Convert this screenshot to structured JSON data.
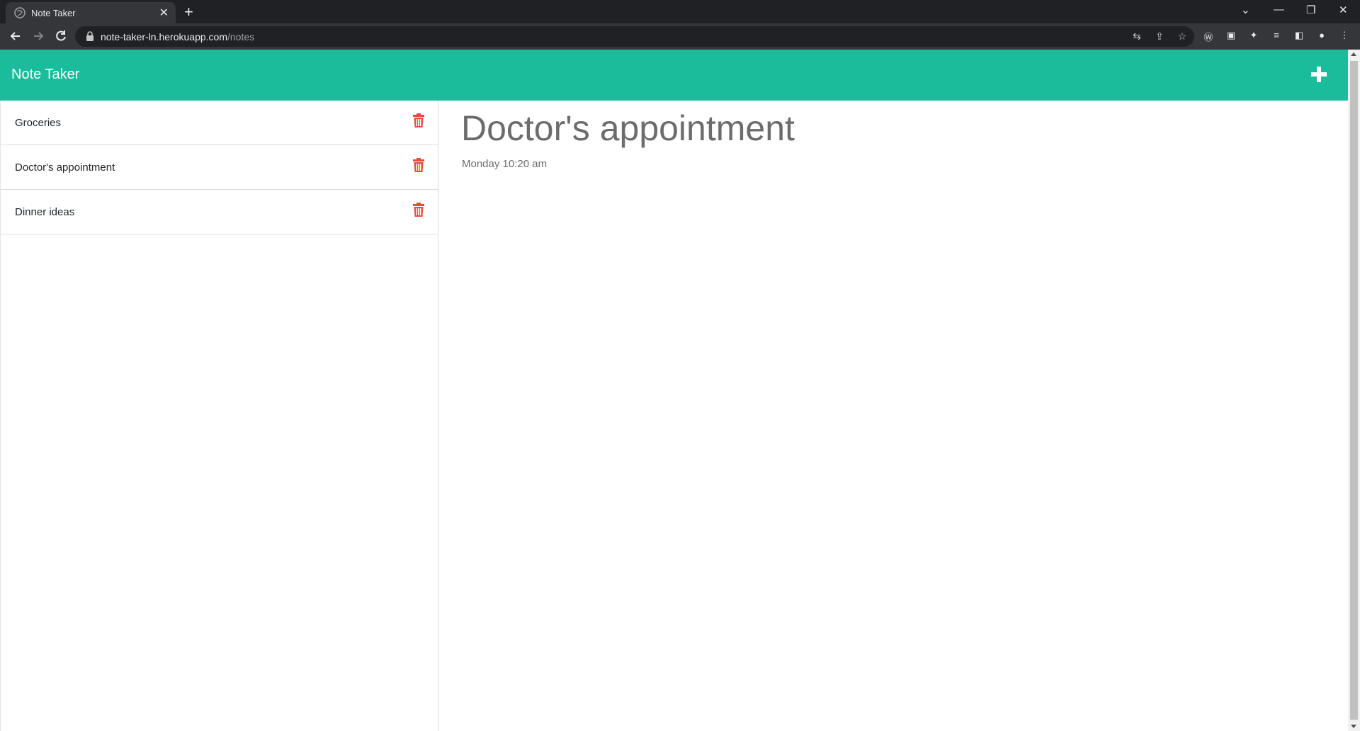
{
  "browser": {
    "tab_title": "Note Taker",
    "url_host": "note-taker-ln.herokuapp.com",
    "url_path": "/notes"
  },
  "header": {
    "brand": "Note Taker"
  },
  "notes": [
    {
      "label": "Groceries"
    },
    {
      "label": "Doctor's appointment"
    },
    {
      "label": "Dinner ideas"
    }
  ],
  "active_note": {
    "title": "Doctor's appointment",
    "text": "Monday 10:20 am"
  },
  "colors": {
    "header_bg": "#1abc9c",
    "trash": "#e74c3c",
    "note_text": "#6c6c6c"
  }
}
